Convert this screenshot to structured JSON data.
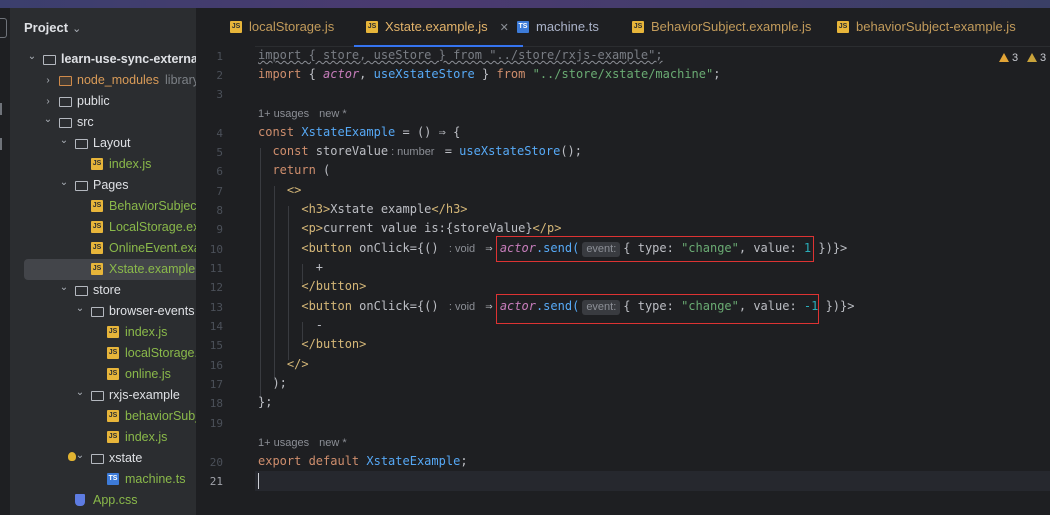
{
  "project_panel": {
    "title": "Project",
    "tree": [
      {
        "label": "learn-use-sync-external",
        "kind": "folder",
        "depth": 0,
        "expanded": true,
        "color": "white",
        "bold": true
      },
      {
        "label": "node_modules",
        "suffix": "library root",
        "kind": "folder-nm",
        "depth": 1,
        "expanded": false,
        "color": "orange"
      },
      {
        "label": "public",
        "kind": "folder",
        "depth": 1,
        "expanded": false,
        "color": "white"
      },
      {
        "label": "src",
        "kind": "folder",
        "depth": 1,
        "expanded": true,
        "color": "white"
      },
      {
        "label": "Layout",
        "kind": "folder",
        "depth": 2,
        "expanded": true,
        "color": "white"
      },
      {
        "label": "index.js",
        "kind": "js",
        "depth": 3,
        "color": "green"
      },
      {
        "label": "Pages",
        "kind": "folder",
        "depth": 2,
        "expanded": true,
        "color": "white"
      },
      {
        "label": "BehaviorSubject",
        "kind": "js",
        "depth": 3,
        "color": "green"
      },
      {
        "label": "LocalStorage.ex",
        "kind": "js",
        "depth": 3,
        "color": "green"
      },
      {
        "label": "OnlineEvent.exa",
        "kind": "js",
        "depth": 3,
        "color": "green"
      },
      {
        "label": "Xstate.example.",
        "kind": "js",
        "depth": 3,
        "color": "green",
        "selected": true
      },
      {
        "label": "store",
        "kind": "folder",
        "depth": 2,
        "expanded": true,
        "color": "white"
      },
      {
        "label": "browser-events",
        "kind": "folder",
        "depth": 3,
        "expanded": true,
        "color": "white"
      },
      {
        "label": "index.js",
        "kind": "js",
        "depth": 4,
        "color": "green"
      },
      {
        "label": "localStorage.",
        "kind": "js",
        "depth": 4,
        "color": "green"
      },
      {
        "label": "online.js",
        "kind": "js",
        "depth": 4,
        "color": "green"
      },
      {
        "label": "rxjs-example",
        "kind": "folder",
        "depth": 3,
        "expanded": true,
        "color": "white"
      },
      {
        "label": "behaviorSubj",
        "kind": "js",
        "depth": 4,
        "color": "green"
      },
      {
        "label": "index.js",
        "kind": "js",
        "depth": 4,
        "color": "green"
      },
      {
        "label": "xstate",
        "kind": "folder",
        "depth": 3,
        "expanded": true,
        "color": "white"
      },
      {
        "label": "machine.ts",
        "kind": "ts",
        "depth": 4,
        "color": "green"
      },
      {
        "label": "App.css",
        "kind": "css",
        "depth": 2,
        "color": "green"
      }
    ]
  },
  "tabs": [
    {
      "label": "localStorage.js",
      "type": "JS"
    },
    {
      "label": "Xstate.example.js",
      "type": "JS",
      "active": true
    },
    {
      "label": "machine.ts",
      "type": "TS"
    },
    {
      "label": "BehaviorSubject.example.js",
      "type": "JS"
    },
    {
      "label": "behaviorSubject-example.js",
      "type": "JS"
    }
  ],
  "warnings": [
    "3",
    "3"
  ],
  "editor": {
    "line_numbers": [
      "1",
      "2",
      "3",
      "4",
      "5",
      "6",
      "7",
      "8",
      "9",
      "10",
      "11",
      "12",
      "13",
      "14",
      "15",
      "16",
      "17",
      "18",
      "19",
      "20",
      "21"
    ],
    "current_line": "21",
    "usages_hint_1": {
      "usages": "1+ usages",
      "new": "new *"
    },
    "usages_hint_2": {
      "usages": "1+ usages",
      "new": "new *"
    },
    "code": {
      "l1": "import { store, useStore } from \"../store/rxjs-example\";",
      "l2_import": "import",
      "l2_open": " { ",
      "l2_actor": "actor",
      "l2_comma": ", ",
      "l2_hook": "useXstateStore",
      "l2_close": " } ",
      "l2_from": "from",
      "l2_path": " \"../store/xstate/machine\"",
      "l2_end": ";",
      "l4_const": "const",
      "l4_name": " XstateExample",
      "l4_rest": " = () ⇒ {",
      "l5_const": "  const",
      "l5_var": " storeValue",
      "l5_hint": ": number",
      "l5_eq": " = ",
      "l5_call": "useXstateStore",
      "l5_end": "();",
      "l6_return": "  return",
      "l6_rest": " (",
      "l7": "    <>",
      "l8_open": "      <h3>",
      "l8_text": "Xstate example",
      "l8_close": "</h3>",
      "l9_open": "      <p>",
      "l9_text": "current value is:{storeValue}",
      "l9_close": "</p>",
      "l10_tag": "      <button",
      "l10_attr": " onClick={() ",
      "l10_hint": ": void",
      "l10_arrow": " ⇒ ",
      "l10_actor": "actor",
      "l10_send": ".send(",
      "l10_param": "event:",
      "l10_obj_a": "{ type: ",
      "l10_str": "\"change\"",
      "l10_obj_b": ", value: ",
      "l10_num": "1",
      "l10_obj_c": " })",
      "l10_end": "}>",
      "l11": "        +",
      "l12": "      </button>",
      "l13_tag": "      <button",
      "l13_attr": " onClick={() ",
      "l13_hint": ": void",
      "l13_arrow": " ⇒ ",
      "l13_actor": "actor",
      "l13_send": ".send(",
      "l13_param": "event:",
      "l13_obj_a": "{ type: ",
      "l13_str": "\"change\"",
      "l13_obj_b": ", value: ",
      "l13_num": "-1",
      "l13_obj_c": " })",
      "l13_end": "}>",
      "l14": "        -",
      "l15": "      </button>",
      "l16": "    </>",
      "l17": "  );",
      "l18": "};",
      "l20_export": "export default",
      "l20_name": " XstateExample",
      "l20_end": ";"
    }
  }
}
